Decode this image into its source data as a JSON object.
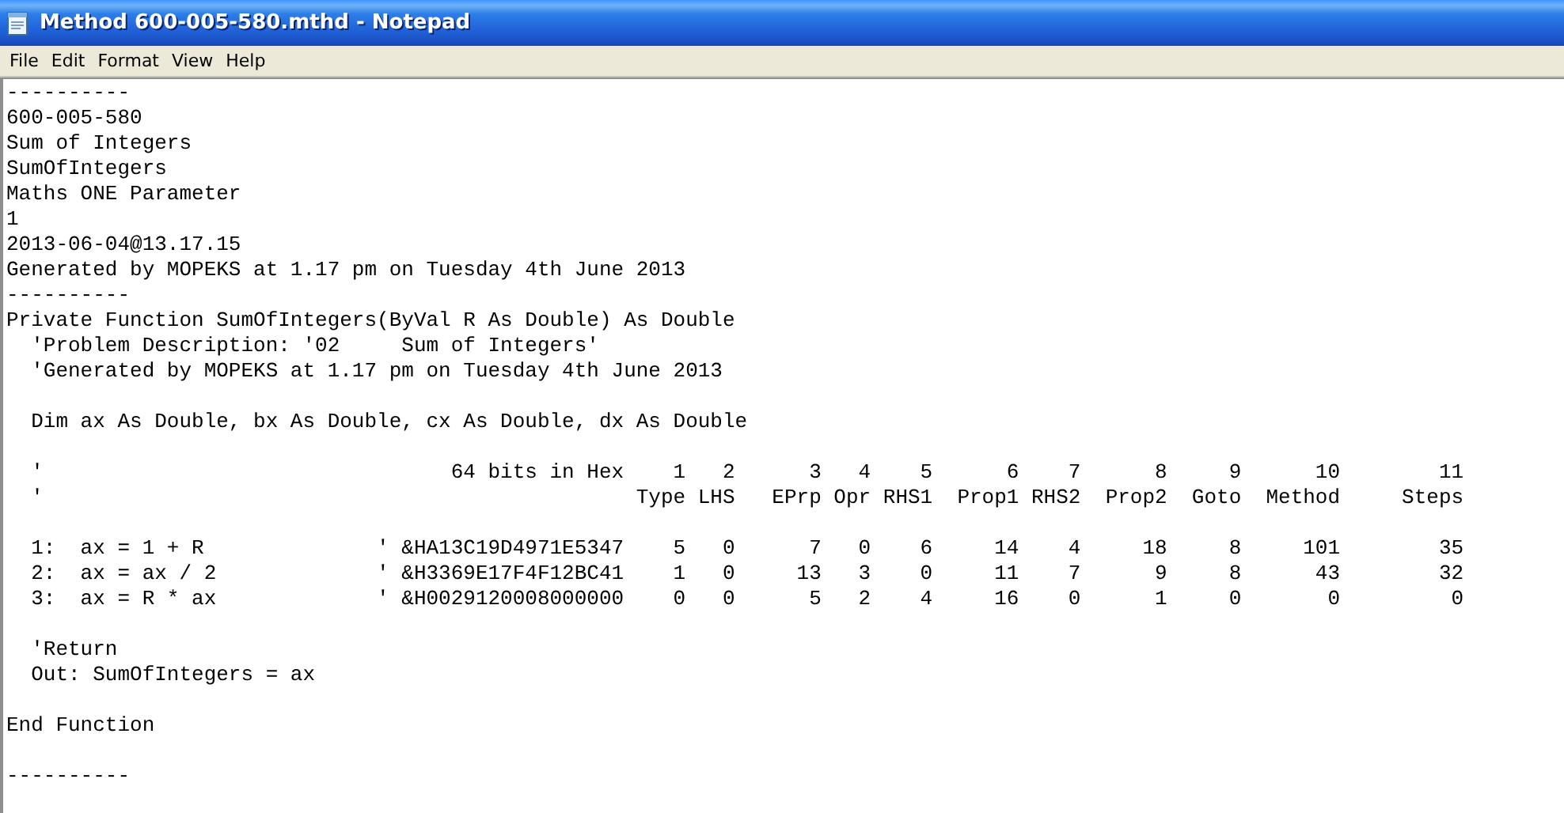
{
  "window": {
    "title": "Method 600-005-580.mthd - Notepad"
  },
  "menu": [
    {
      "label": "File"
    },
    {
      "label": "Edit"
    },
    {
      "label": "Format"
    },
    {
      "label": "View"
    },
    {
      "label": "Help"
    }
  ],
  "document": {
    "lines": [
      {
        "kind": "text",
        "text": "----------"
      },
      {
        "kind": "text",
        "text": "600-005-580"
      },
      {
        "kind": "text",
        "text": "Sum of Integers"
      },
      {
        "kind": "text",
        "text": "SumOfIntegers"
      },
      {
        "kind": "text",
        "text": "Maths ONE Parameter"
      },
      {
        "kind": "text",
        "text": "1"
      },
      {
        "kind": "text",
        "text": "2013-06-04@13.17.15"
      },
      {
        "kind": "text",
        "text": "Generated by MOPEKS at 1.17 pm on Tuesday 4th June 2013"
      },
      {
        "kind": "text",
        "text": "----------"
      },
      {
        "kind": "text",
        "text": "Private Function SumOfIntegers(ByVal R As Double) As Double"
      },
      {
        "kind": "text",
        "text": "  'Problem Description: '02     Sum of Integers'"
      },
      {
        "kind": "text",
        "text": "  'Generated by MOPEKS at 1.17 pm on Tuesday 4th June 2013"
      },
      {
        "kind": "blank"
      },
      {
        "kind": "text",
        "text": "  Dim ax As Double, bx As Double, cx As Double, dx As Double"
      },
      {
        "kind": "blank"
      },
      {
        "kind": "text",
        "text": "  '                                 64 bits in Hex    1   2      3   4    5      6    7      8     9      10        11"
      },
      {
        "kind": "text",
        "text": "  '                                                Type LHS   EPrp Opr RHS1  Prop1 RHS2  Prop2  Goto  Method     Steps"
      },
      {
        "kind": "blank"
      },
      {
        "kind": "text",
        "text": "  1:  ax = 1 + R              ' &HA13C19D4971E5347    5   0      7   0    6     14    4     18     8     101        35"
      },
      {
        "kind": "text",
        "text": "  2:  ax = ax / 2             ' &H3369E17F4F12BC41    1   0     13   3    0     11    7      9     8      43        32"
      },
      {
        "kind": "text",
        "text": "  3:  ax = R * ax             ' &H0029120008000000    0   0      5   2    4     16    0      1     0       0         0"
      },
      {
        "kind": "blank"
      },
      {
        "kind": "text",
        "text": "  'Return"
      },
      {
        "kind": "text",
        "text": "  Out: SumOfIntegers = ax"
      },
      {
        "kind": "blank"
      },
      {
        "kind": "text",
        "text": "End Function"
      },
      {
        "kind": "blank"
      },
      {
        "kind": "text",
        "text": "----------"
      }
    ]
  }
}
